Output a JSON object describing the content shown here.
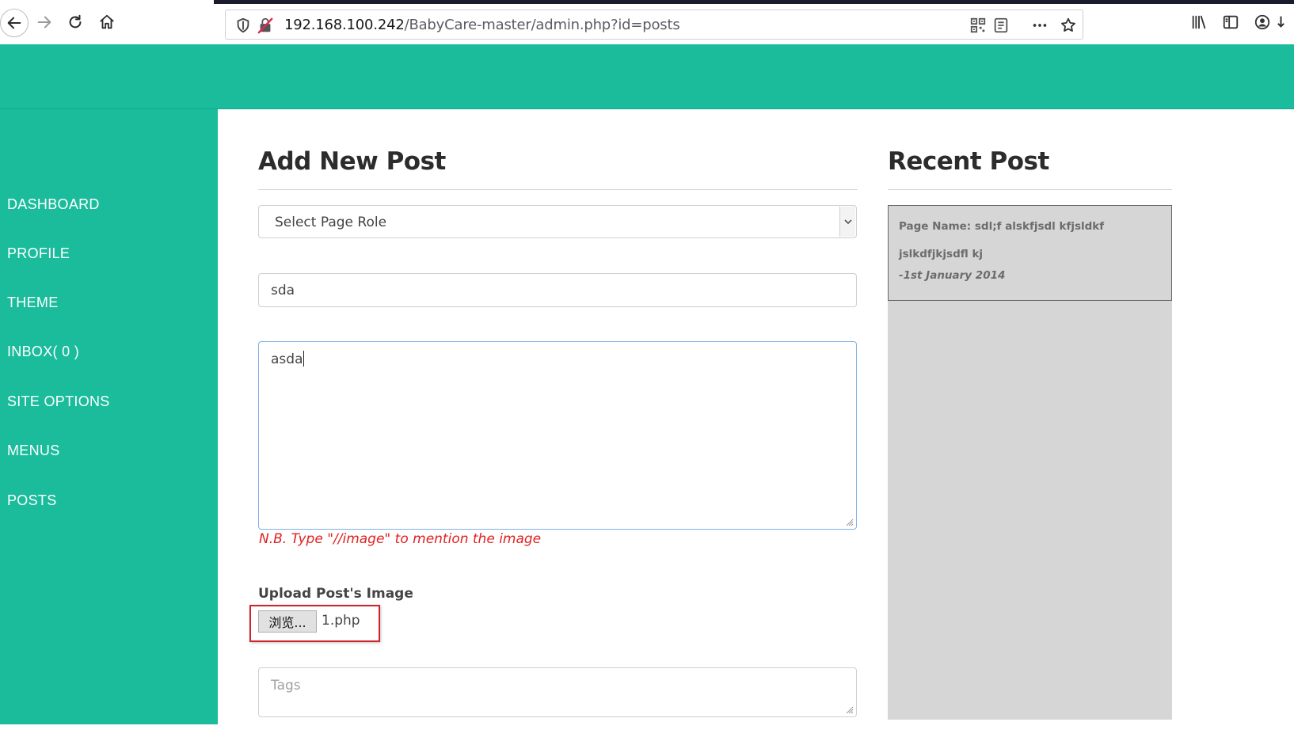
{
  "browser": {
    "url_host": "192.168.100.242",
    "url_path": "/BabyCare-master/admin.php?id=posts"
  },
  "sidebar": {
    "items": [
      {
        "label": "DASHBOARD"
      },
      {
        "label": "PROFILE"
      },
      {
        "label": "THEME"
      },
      {
        "label": "INBOX( 0 )"
      },
      {
        "label": "SITE OPTIONS"
      },
      {
        "label": "MENUS"
      },
      {
        "label": "POSTS"
      }
    ]
  },
  "main": {
    "title": "Add New Post",
    "select_role": "Select Page Role",
    "post_title_value": "sda",
    "content_value": "asda",
    "note": "N.B. Type \"//image\" to mention the image",
    "upload_label": "Upload Post's Image",
    "browse_label": "浏览...",
    "file_name": "1.php",
    "tags_placeholder": "Tags"
  },
  "recent": {
    "title": "Recent Post",
    "items": [
      {
        "name": "Page Name: sdl;f alskfjsdl kfjsldkf jslkdfjkjsdfl kj",
        "date": "-1st January 2014"
      }
    ]
  },
  "colors": {
    "brand": "#1abc9c",
    "note": "#e02020",
    "highlight": "#d0242b",
    "panel": "#d6d6d6"
  }
}
